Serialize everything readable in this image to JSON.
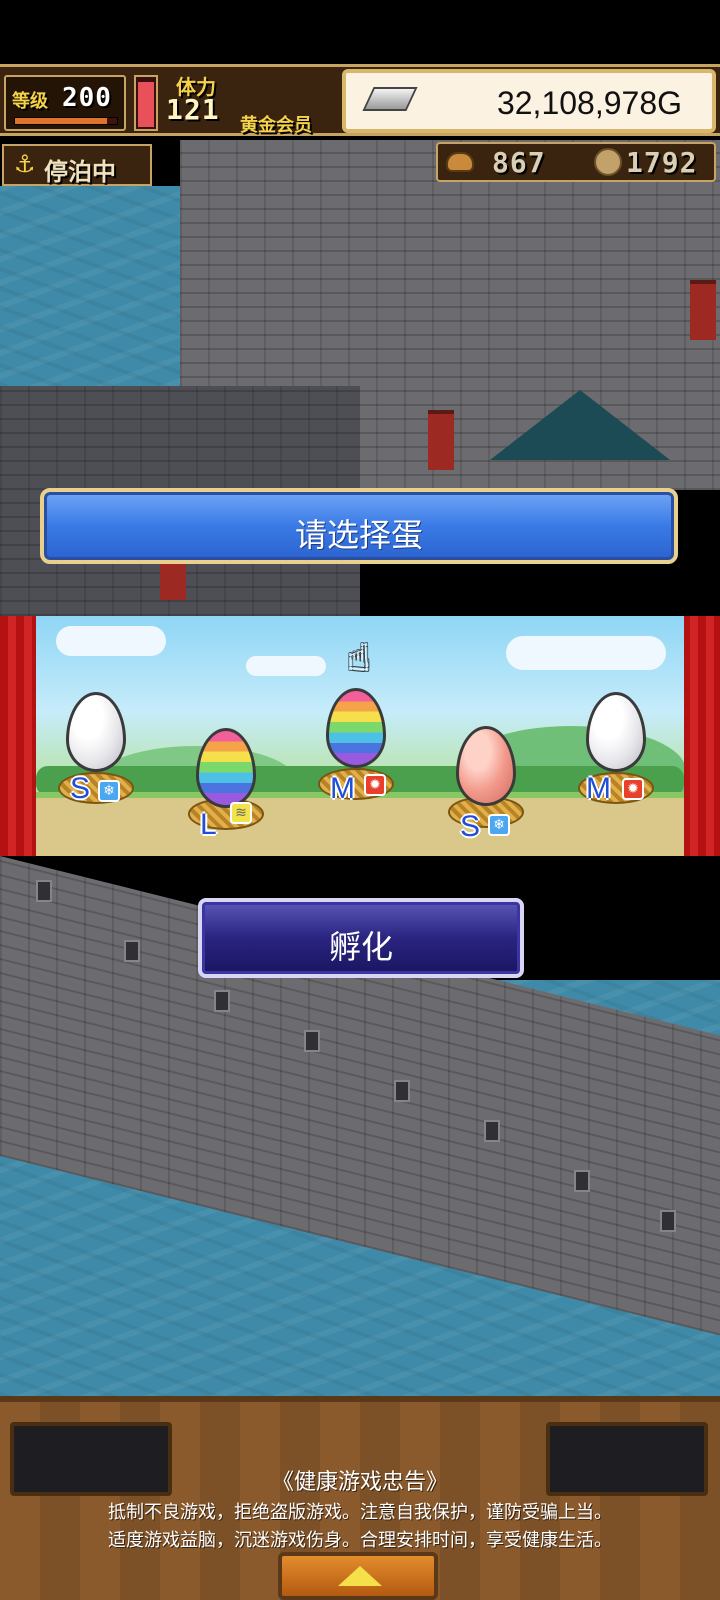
{
  "hud": {
    "level_label": "等级",
    "level_value": "200",
    "exp_fraction": 0.9,
    "stamina_label": "体力",
    "stamina_value": "121",
    "stamina_fraction": 0.95,
    "member_label": "黄金会员",
    "gold_value": "32,108,978G",
    "anchor_icon": "anchor-icon",
    "anchor_status": "停泊中",
    "bread_value": "867",
    "medal_value": "1792"
  },
  "egg_select": {
    "title": "请选择蛋",
    "hatch_label": "孵化",
    "eggs": [
      {
        "type": "white",
        "size": "S",
        "element": "ice"
      },
      {
        "type": "rainbow",
        "size": "L",
        "element": "wind"
      },
      {
        "type": "rainbow",
        "size": "M",
        "element": "fire"
      },
      {
        "type": "pink",
        "size": "S",
        "element": "ice"
      },
      {
        "type": "white",
        "size": "M",
        "element": "fire"
      }
    ]
  },
  "notice": {
    "title": "《健康游戏忠告》",
    "line1": "抵制不良游戏，拒绝盗版游戏。注意自我保护，谨防受骗上当。",
    "line2": "适度游戏益脑，沉迷游戏伤身。合理安排时间，享受健康生活。"
  },
  "colors": {
    "banner_blue": "#3a7ae6",
    "hatch_purple": "#2a2480",
    "hud_brown": "#3a2410",
    "sea": "#3f8aa8"
  }
}
